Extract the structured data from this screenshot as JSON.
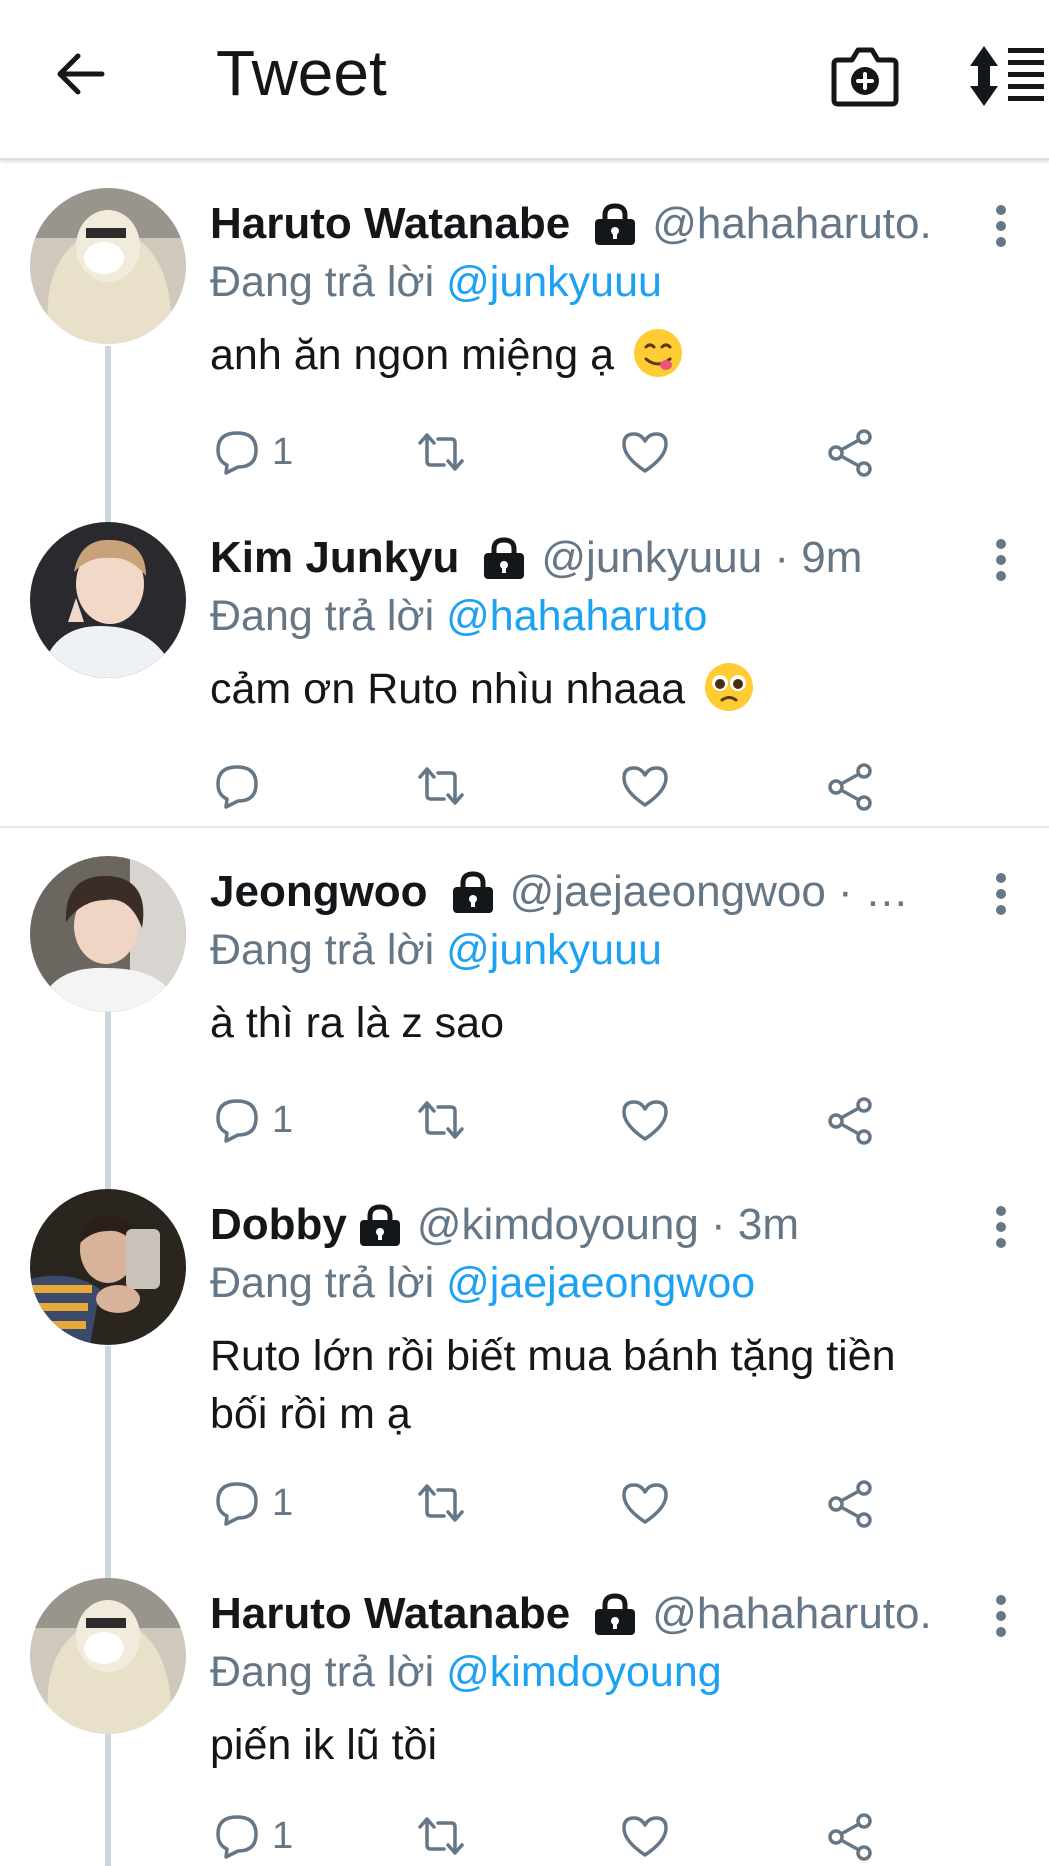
{
  "header": {
    "title": "Tweet",
    "back_icon": "arrow-left-icon",
    "camera_icon": "camera-plus-icon",
    "sort_icon": "sort-list-icon"
  },
  "colors": {
    "accent": "#1da1f2",
    "secondary_text": "#657786",
    "primary_text": "#14171a"
  },
  "tweets": [
    {
      "name": "Haruto Watanabe",
      "handle": "@hahaharuto.",
      "reply_prefix": "Đang trả lời",
      "reply_to": "@junkyuuu",
      "text": "anh ăn ngon miệng ạ",
      "emoji": "yum-face-emoji",
      "reply_count": "1"
    },
    {
      "name": "Kim Junkyu",
      "handle": "@junkyuuu · 9m",
      "reply_prefix": "Đang trả lời",
      "reply_to": "@hahaharuto",
      "text": "cảm ơn Ruto nhìu nhaaa",
      "emoji": "pleading-face-emoji",
      "reply_count": ""
    },
    {
      "name": "Jeongwoo",
      "handle": "@jaejaeongwoo · …",
      "reply_prefix": "Đang trả lời",
      "reply_to": "@junkyuuu",
      "text": "à thì ra là z sao",
      "emoji": "",
      "reply_count": "1"
    },
    {
      "name": "Dobby",
      "handle": "@kimdoyoung · 3m",
      "reply_prefix": "Đang trả lời",
      "reply_to": "@jaejaeongwoo",
      "text_line1": "Ruto lớn rồi biết mua bánh tặng tiền",
      "text_line2": "bối rồi m ạ",
      "reply_count": "1"
    },
    {
      "name": "Haruto Watanabe",
      "handle": "@hahaharuto.",
      "reply_prefix": "Đang trả lời",
      "reply_to": "@kimdoyoung",
      "text": "piến ik lũ tồi",
      "emoji": "",
      "reply_count": "1"
    }
  ]
}
